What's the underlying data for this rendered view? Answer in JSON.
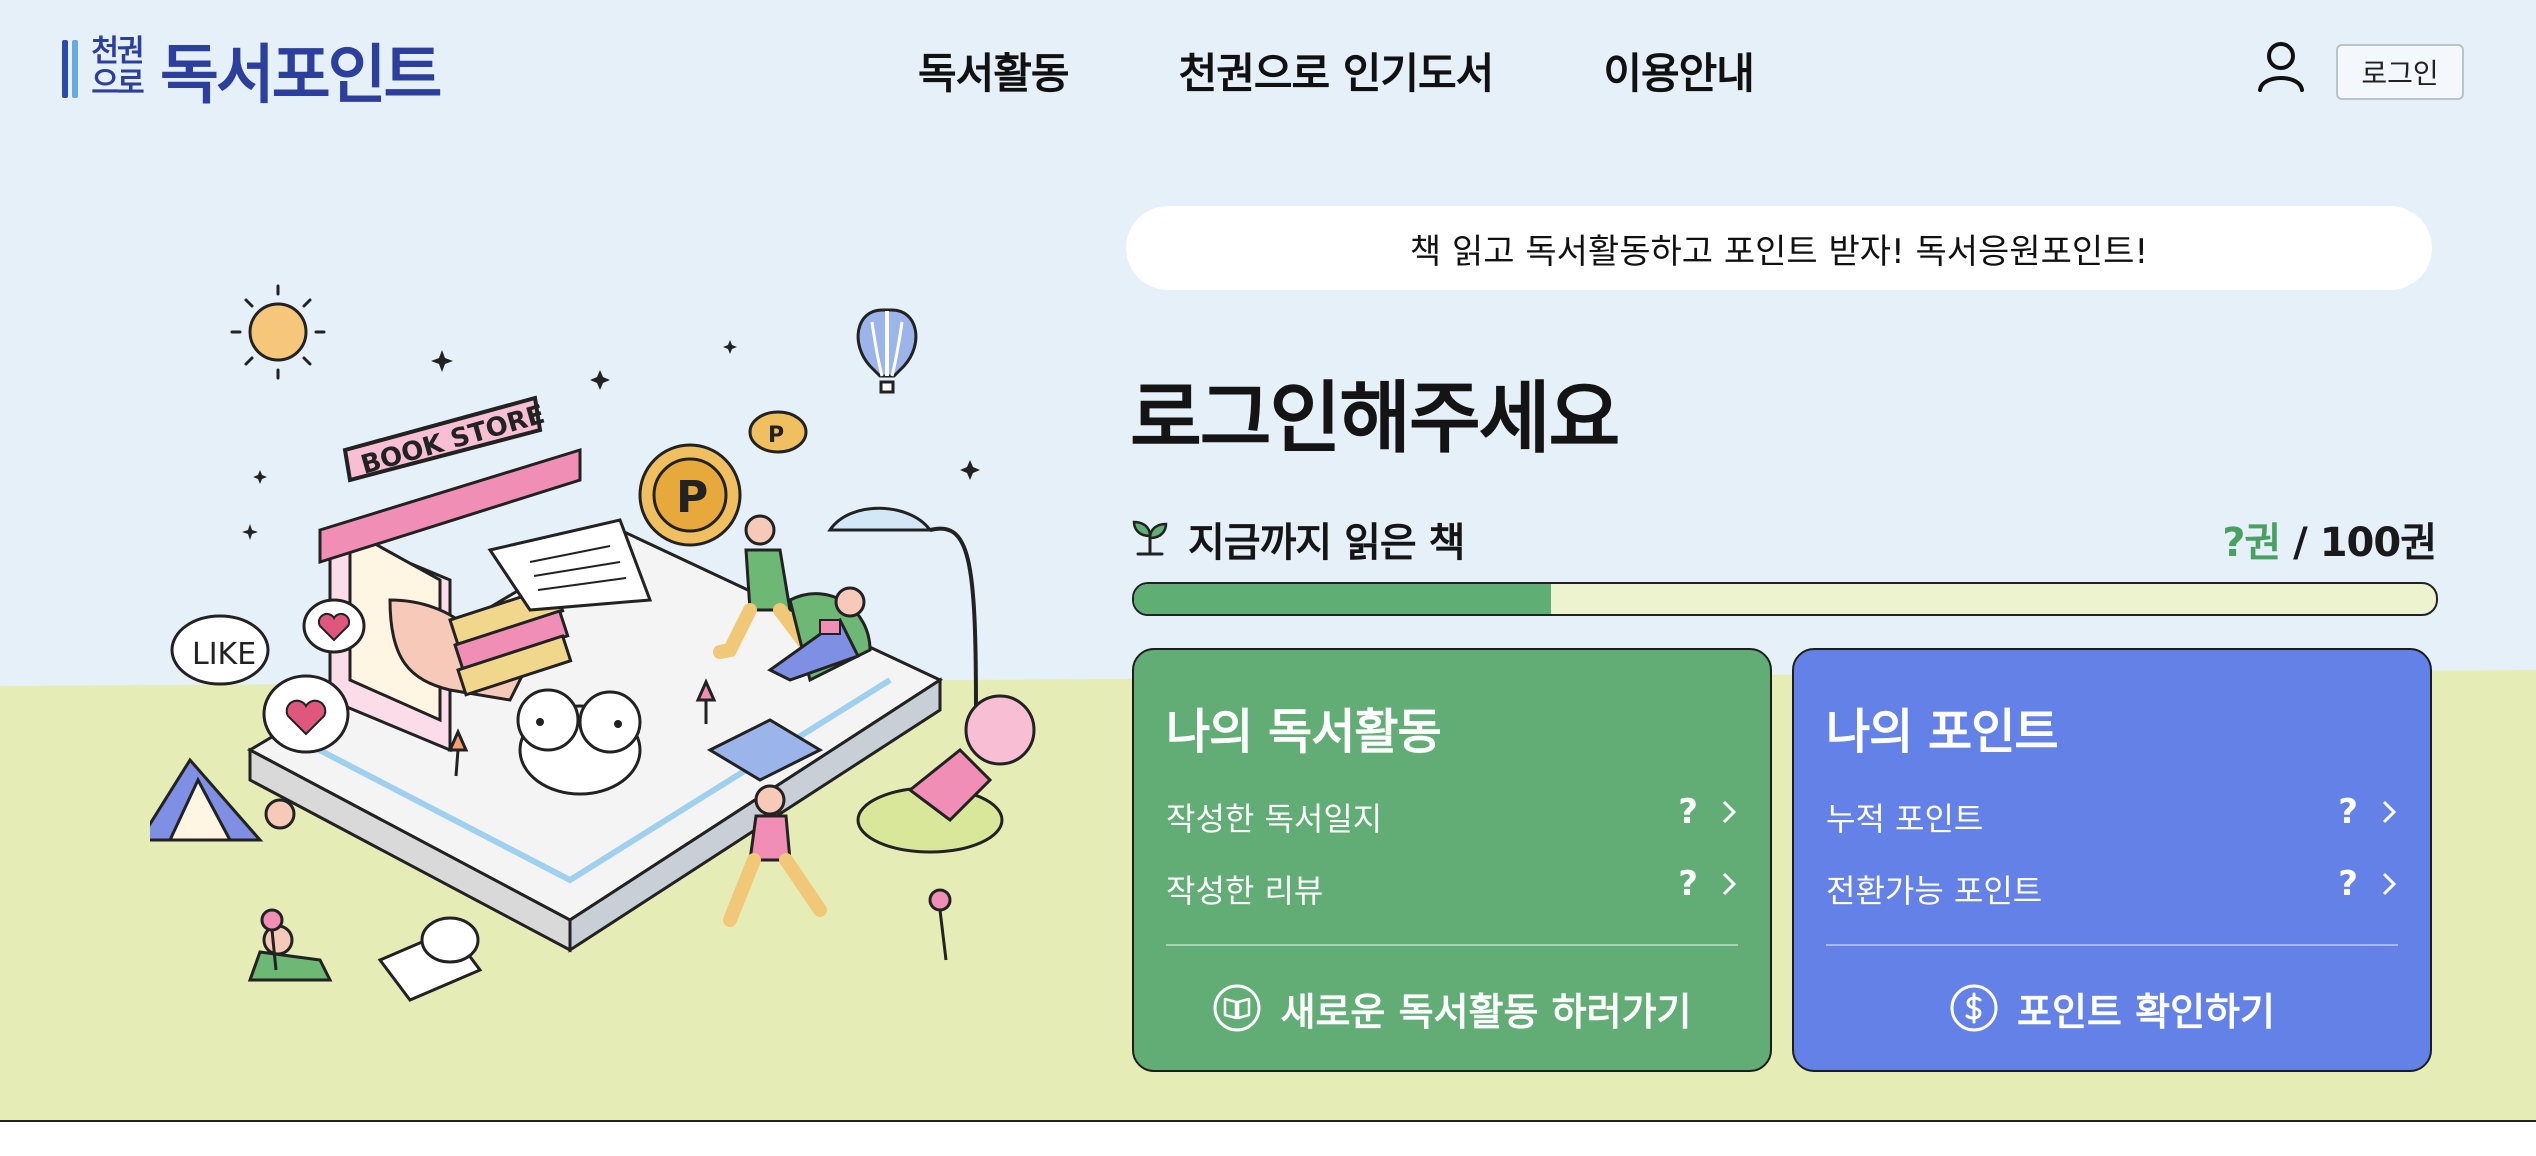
{
  "header": {
    "logo_mark": "천권\n으로",
    "logo_text": "독서포인트",
    "nav": [
      "독서활동",
      "천권으로 인기도서",
      "이용안내"
    ],
    "login_label": "로그인"
  },
  "hero": {
    "slogan": "책 읽고 독서활동하고 포인트 받자! 독서응원포인트!",
    "title": "로그인해주세요",
    "read_label": "지금까지 읽은 책",
    "read_current": "?권",
    "read_total": " / 100권",
    "progress_fraction": 0.32,
    "illustration_texts": {
      "store_sign": "BOOK STORE",
      "like_bubble": "LIKE",
      "coin": "P"
    }
  },
  "cards": {
    "activity": {
      "title": "나의 독서활동",
      "rows": [
        {
          "label": "작성한 독서일지",
          "value": "?"
        },
        {
          "label": "작성한 리뷰",
          "value": "?"
        }
      ],
      "action_label": "새로운 독서활동 하러가기",
      "icon": "book-icon"
    },
    "points": {
      "title": "나의 포인트",
      "rows": [
        {
          "label": "누적 포인트",
          "value": "?"
        },
        {
          "label": "전환가능 포인트",
          "value": "?"
        }
      ],
      "action_label": "포인트 확인하기",
      "icon": "dollar-icon"
    }
  },
  "colors": {
    "sky": "#e6f0f8",
    "ground": "#e6ecb5",
    "accent_navy": "#2d3f9c",
    "card_green": "#61ad75",
    "card_blue": "#6381e6",
    "progress_fill": "#5fae74",
    "progress_track": "#eef3cf"
  }
}
